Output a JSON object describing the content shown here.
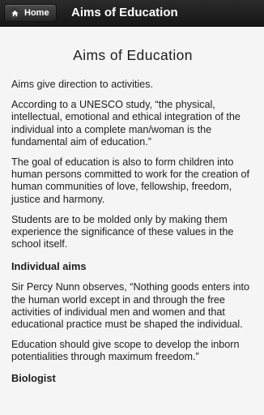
{
  "header": {
    "home_label": "Home",
    "title": "Aims of Education"
  },
  "article": {
    "title": "Aims of Education",
    "paragraphs": [
      "Aims give direction to activities.",
      "According to a UNESCO study, “the physical, intellectual, emotional and ethical integration of the individual into a complete man/woman is the fundamental aim of education.”",
      "The goal of education is also to form children into human persons committed to work for the creation of human communities of love, fellowship, freedom, justice and harmony.",
      "Students are to be molded only by making them experience the significance of these values in the school itself."
    ],
    "section_heading": "Individual aims",
    "section_paragraphs": [
      "Sir Percy Nunn observes, “Nothing goods enters into the human world except in and through the free activities of individual men and women and that educational practice must be shaped the individual.",
      "Education should give scope to develop the inborn potentialities through maximum freedom.”"
    ],
    "next_heading": "Biologist"
  }
}
